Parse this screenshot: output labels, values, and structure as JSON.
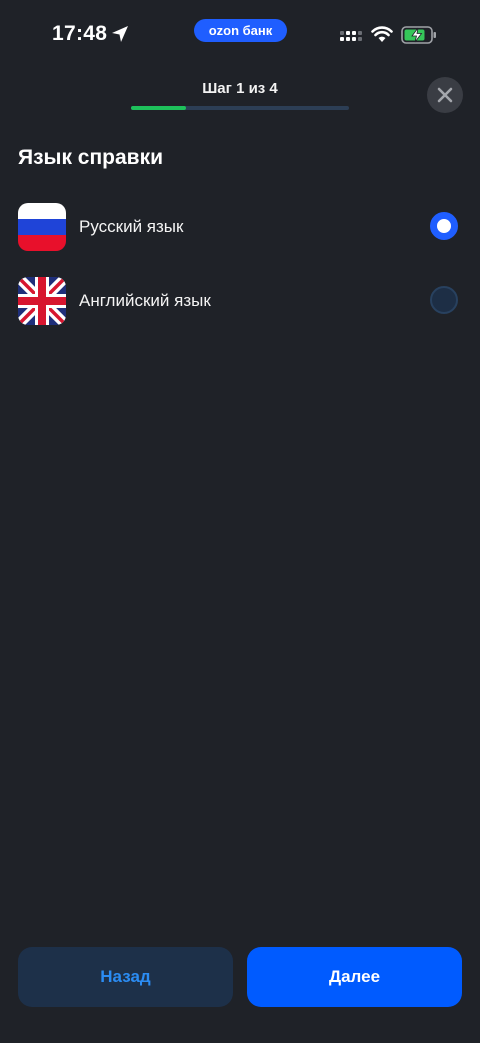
{
  "status_bar": {
    "time": "17:48",
    "app_badge": "ozon банк",
    "battery_state": "charging"
  },
  "header": {
    "step_label": "Шаг 1 из 4",
    "progress_fraction": 0.25,
    "accent_color": "#1ec15b"
  },
  "section": {
    "title": "Язык справки"
  },
  "options": [
    {
      "label": "Русский язык",
      "flag_icon": "russia-flag-icon",
      "selected": true
    },
    {
      "label": "Английский язык",
      "flag_icon": "uk-flag-icon",
      "selected": false
    }
  ],
  "buttons": {
    "back_label": "Назад",
    "next_label": "Далее"
  },
  "colors": {
    "background": "#1f2228",
    "primary": "#005bff",
    "secondary_button": "#1d3049"
  }
}
